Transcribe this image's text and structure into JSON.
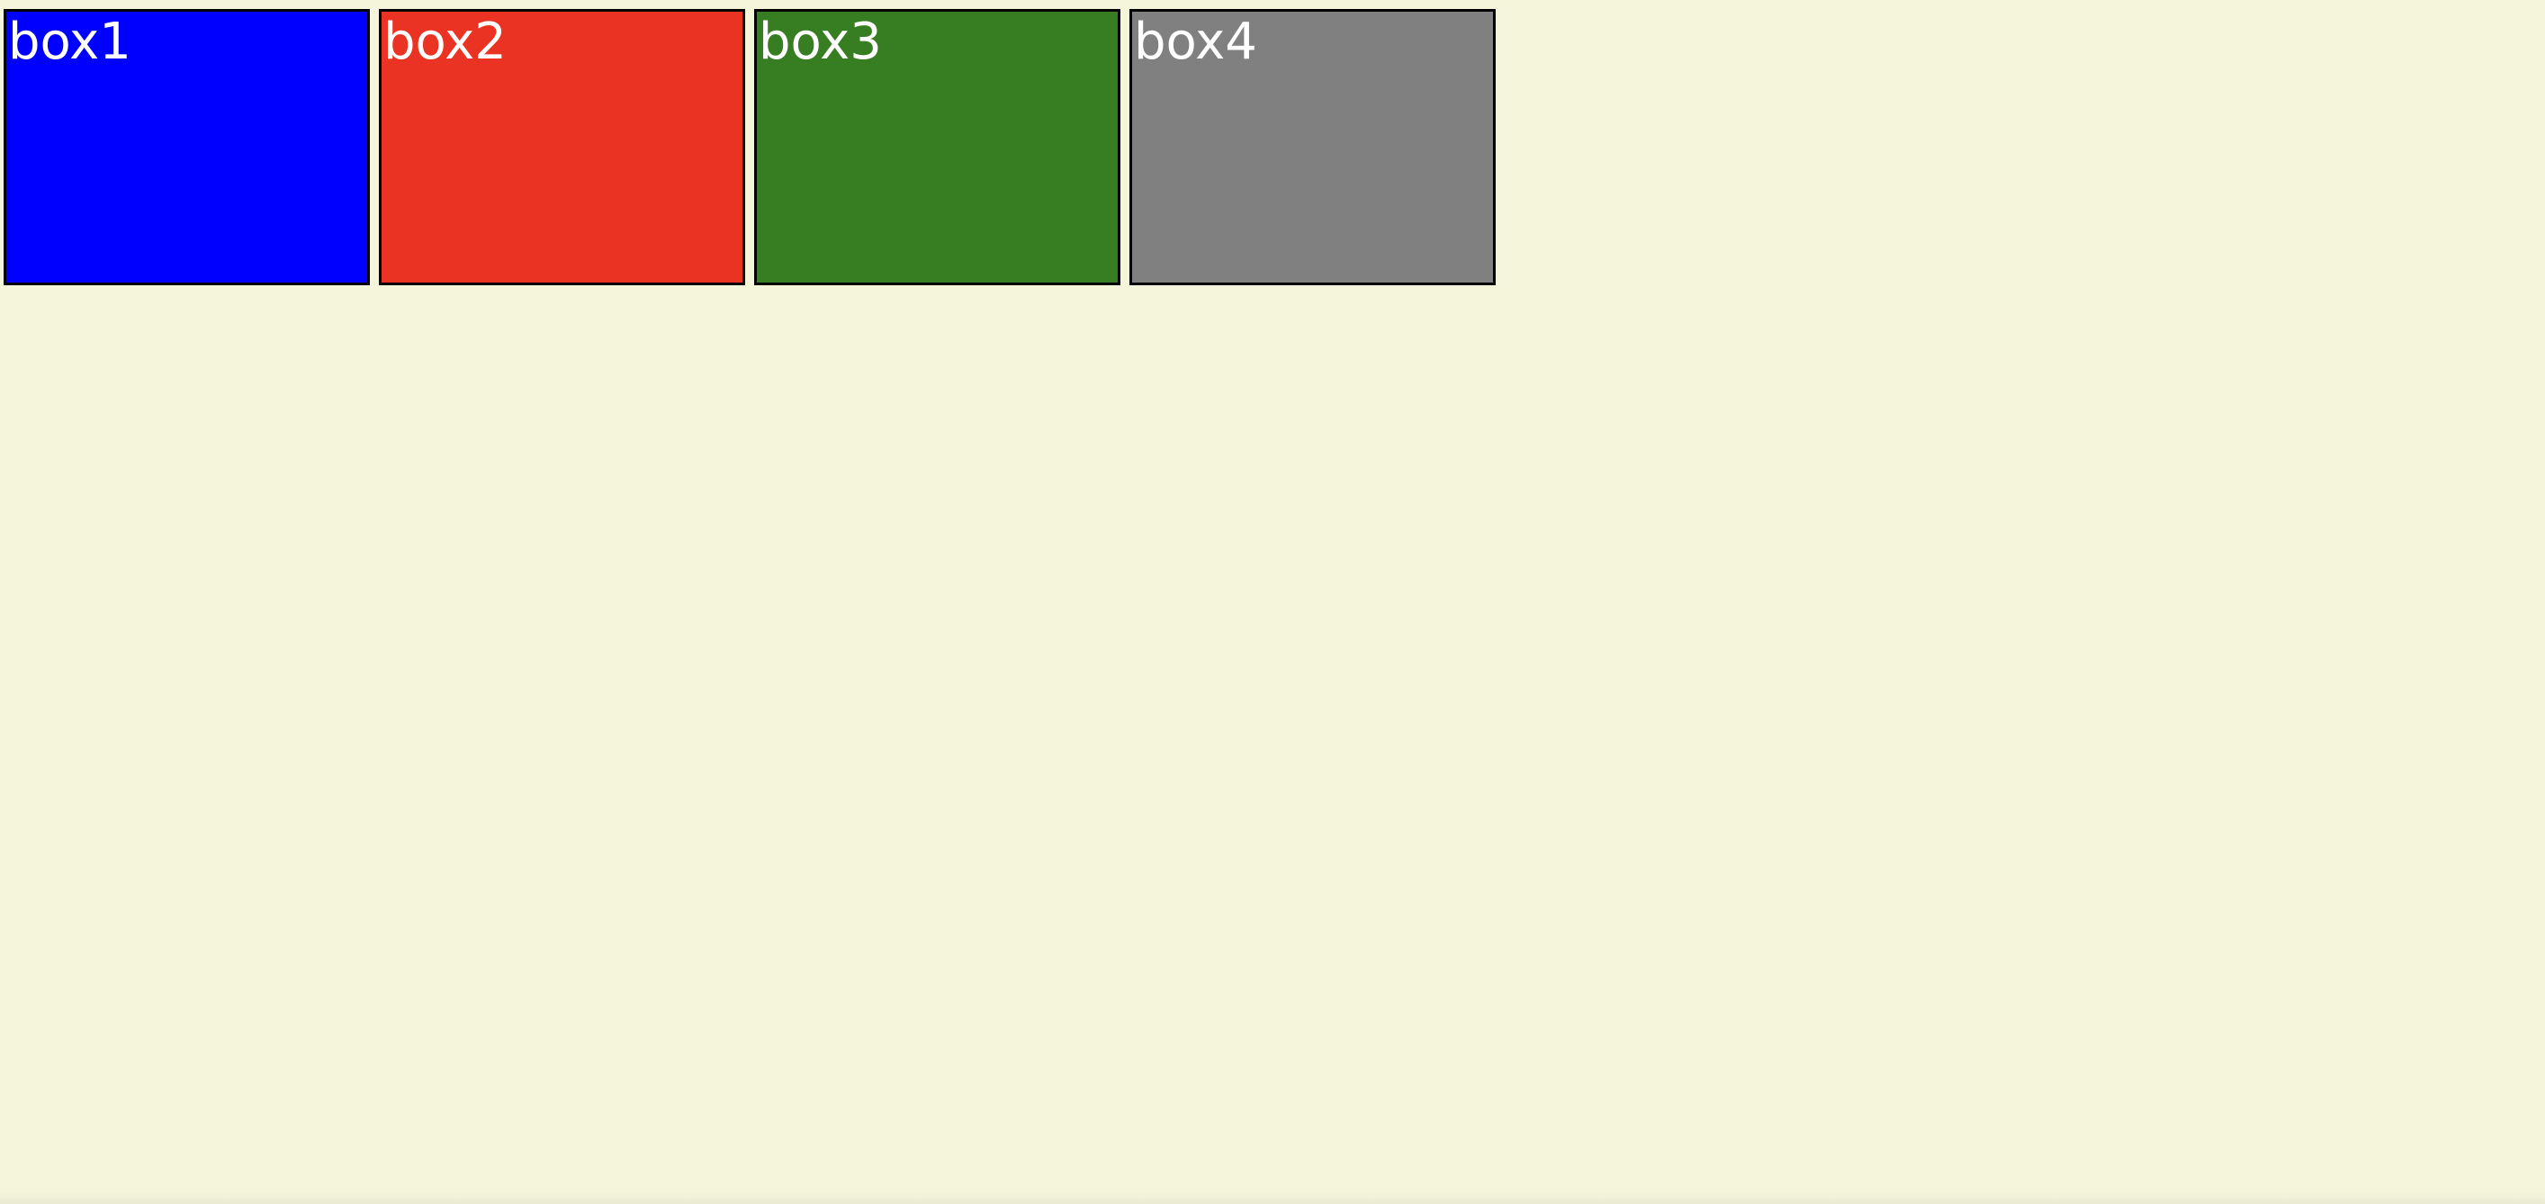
{
  "page": {
    "background_color": "#f5f5dc"
  },
  "boxes": [
    {
      "label": "box1",
      "color": "#0000ff"
    },
    {
      "label": "box2",
      "color": "#ea3323"
    },
    {
      "label": "box3",
      "color": "#377d22"
    },
    {
      "label": "box4",
      "color": "#808080"
    }
  ]
}
